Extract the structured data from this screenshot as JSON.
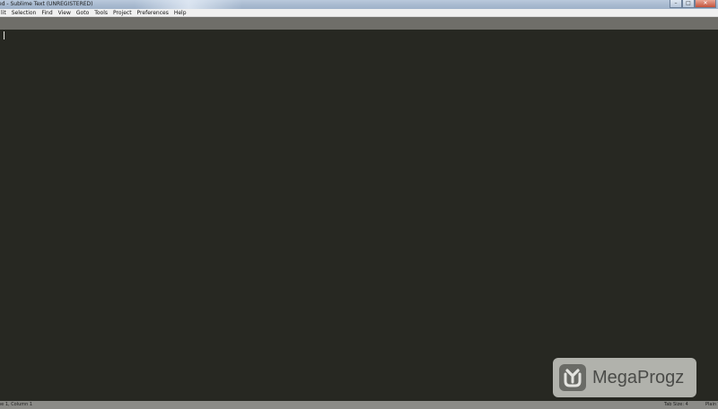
{
  "window": {
    "title": "ed - Sublime Text (UNREGISTERED)",
    "controls": {
      "minimize": "–",
      "maximize": "□",
      "close": "✕"
    }
  },
  "menu": {
    "items": [
      "lit",
      "Selection",
      "Find",
      "View",
      "Goto",
      "Tools",
      "Project",
      "Preferences",
      "Help"
    ]
  },
  "editor": {
    "content": "",
    "background_color": "#272822",
    "caret_color": "#e8e8e2"
  },
  "statusbar": {
    "position": "ne 1, Column 1",
    "tab_size": "Tab Size: 4",
    "syntax": "Plain T"
  },
  "watermark": {
    "text": "MegaProgz",
    "logo_icon": "download-arrow-icon"
  },
  "colors": {
    "tabbar": "#6f6e69",
    "statusbar": "#8b8b87",
    "menubar": "#f0f0f0"
  }
}
